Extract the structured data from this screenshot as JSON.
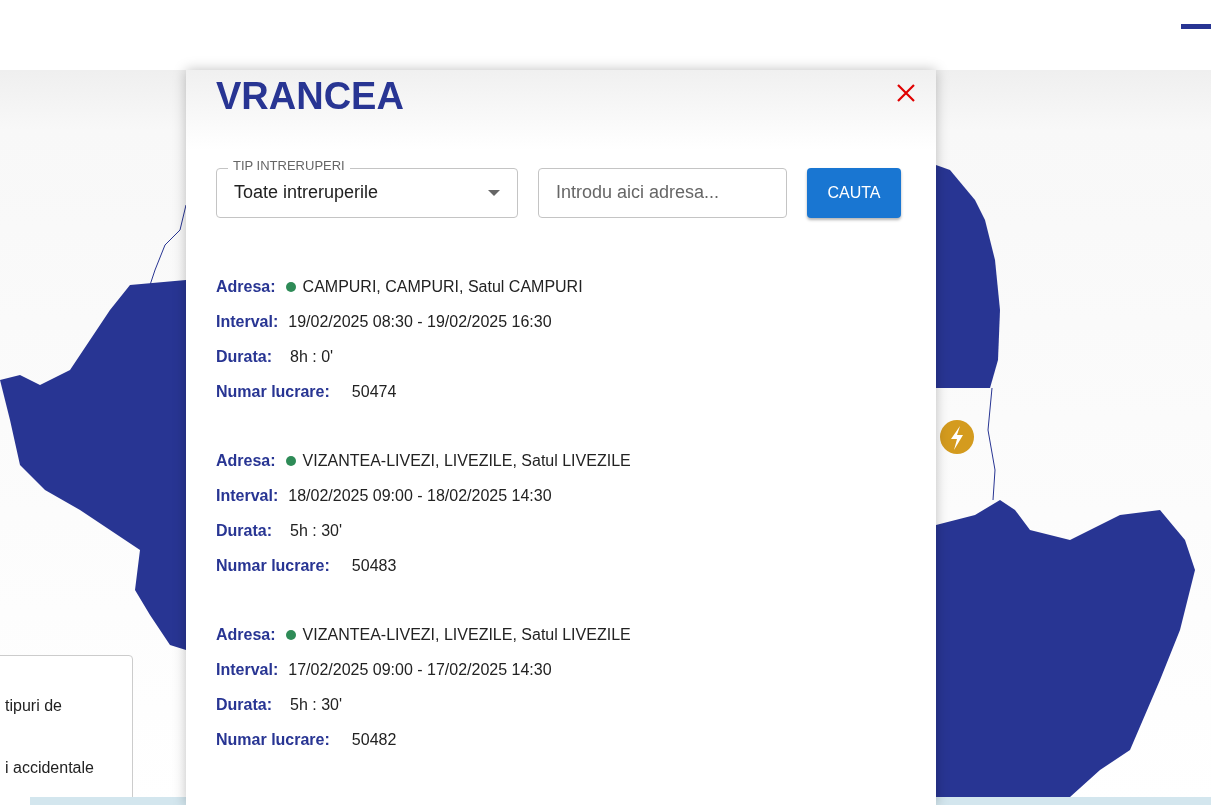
{
  "modal": {
    "title": "VRANCEA",
    "filter": {
      "label": "TIP INTRERUPERI",
      "value": "Toate intreruperile"
    },
    "search": {
      "placeholder": "Introdu aici adresa..."
    },
    "search_button": "CAUTA",
    "results": [
      {
        "address_label": "Adresa:",
        "color": "#2e8b57",
        "address": "CAMPURI, CAMPURI, Satul CAMPURI",
        "interval_label": "Interval:",
        "interval": "19/02/2025 08:30 - 19/02/2025 16:30",
        "duration_label": "Durata:",
        "duration": "8h : 0'",
        "number_label": "Numar lucrare:",
        "number": "50474"
      },
      {
        "address_label": "Adresa:",
        "color": "#2e8b57",
        "address": "VIZANTEA-LIVEZI, LIVEZILE, Satul LIVEZILE",
        "interval_label": "Interval:",
        "interval": "18/02/2025 09:00 - 18/02/2025 14:30",
        "duration_label": "Durata:",
        "duration": "5h : 30'",
        "number_label": "Numar lucrare:",
        "number": "50483"
      },
      {
        "address_label": "Adresa:",
        "color": "#2e8b57",
        "address": "VIZANTEA-LIVEZI, LIVEZILE, Satul LIVEZILE",
        "interval_label": "Interval:",
        "interval": "17/02/2025 09:00 - 17/02/2025 14:30",
        "duration_label": "Durata:",
        "duration": "5h : 30'",
        "number_label": "Numar lucrare:",
        "number": "50482"
      }
    ]
  },
  "legend": {
    "lines": [
      "tipuri de",
      "i accidentale"
    ]
  }
}
